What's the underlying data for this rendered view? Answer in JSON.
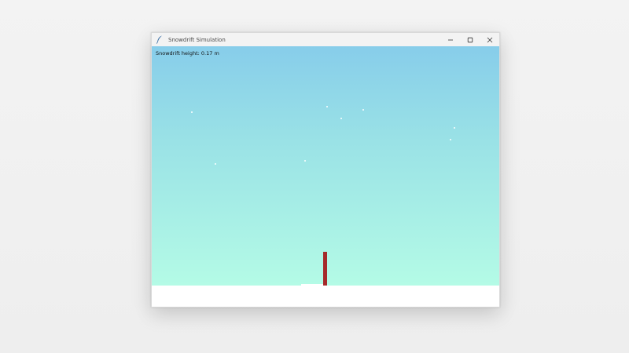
{
  "window": {
    "title": "Snowdrift Simulation",
    "app_icon": "feather-icon",
    "controls": [
      "minimize-icon",
      "maximize-icon",
      "close-icon"
    ]
  },
  "canvas": {
    "status_text": "Snowdrift height: 0.17 m",
    "sky_gradient": [
      "#87cdea",
      "#b4fbe6"
    ],
    "ground_color": "#ffffff",
    "post_color": "#a52a2a",
    "snowflake_color": "#ffffff",
    "snowflake_count": 9
  }
}
